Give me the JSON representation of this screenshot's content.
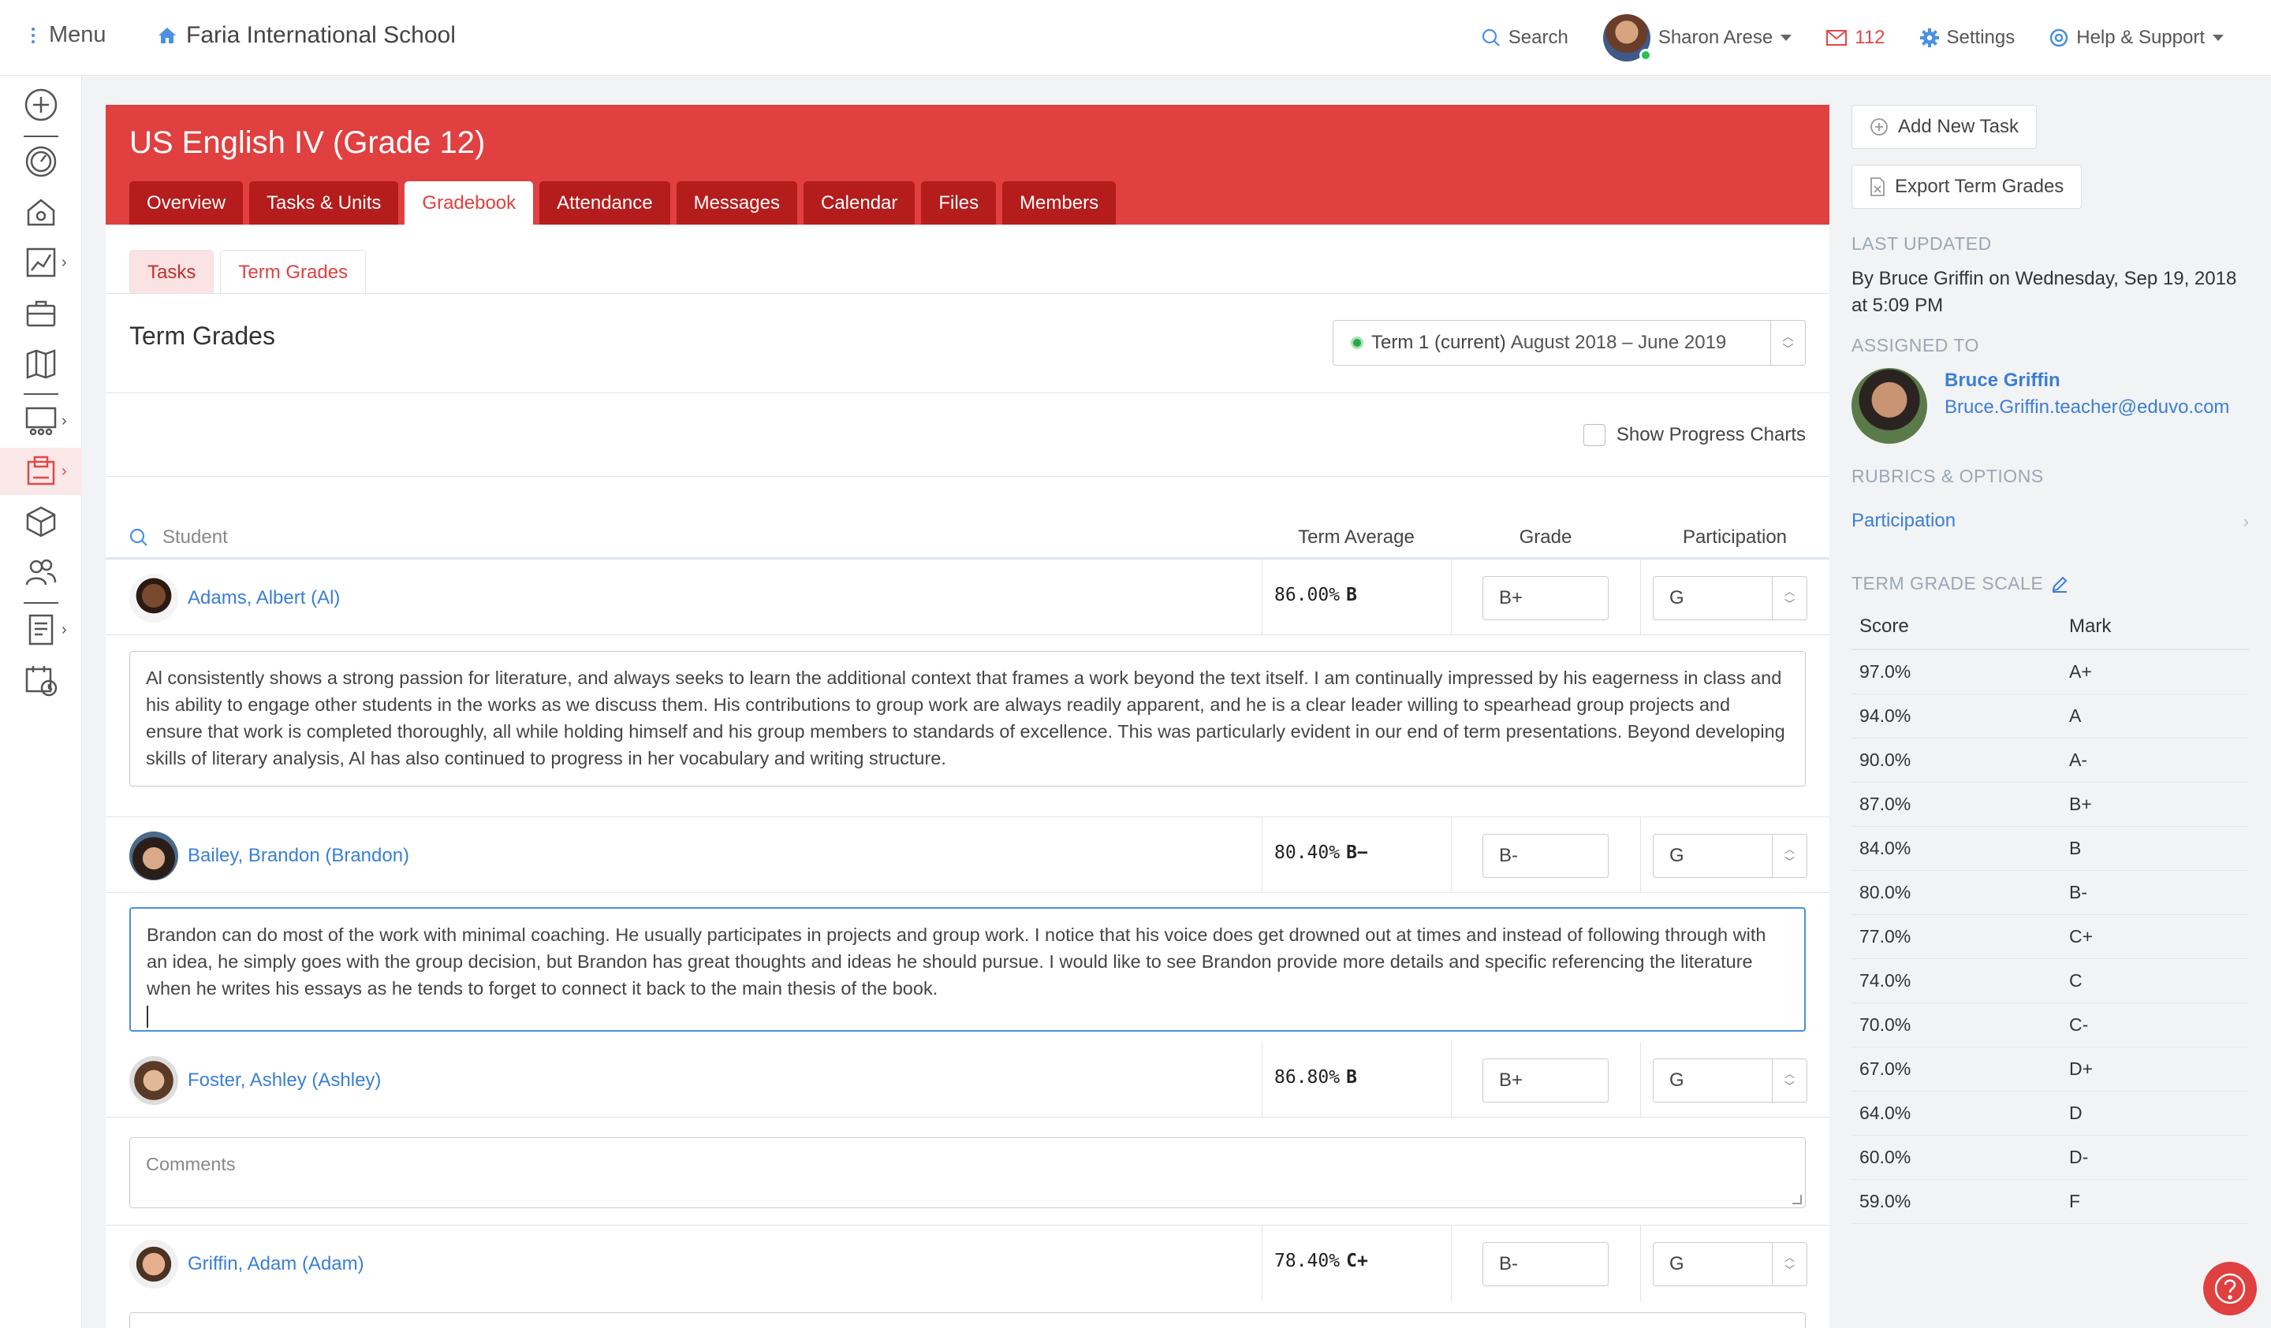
{
  "topbar": {
    "menu_label": "Menu",
    "school_name": "Faria International School",
    "search_label": "Search",
    "user_name": "Sharon Arese",
    "mail_count": "112",
    "settings_label": "Settings",
    "help_label": "Help & Support"
  },
  "course": {
    "title": "US English IV (Grade 12)",
    "tabs": [
      "Overview",
      "Tasks & Units",
      "Gradebook",
      "Attendance",
      "Messages",
      "Calendar",
      "Files",
      "Members"
    ],
    "active_tab": "Gradebook"
  },
  "subtabs": [
    "Tasks",
    "Term Grades"
  ],
  "section_title": "Term Grades",
  "term_select": {
    "label": "Term 1 (current)",
    "dates": "August 2018 – June 2019"
  },
  "show_progress_charts": "Show Progress Charts",
  "table": {
    "student_placeholder": "Student",
    "col_average": "Term Average",
    "col_grade": "Grade",
    "col_participation": "Participation",
    "rows": [
      {
        "name": "Adams, Albert (Al)",
        "average": "86.00%",
        "average_mark": "B",
        "grade": "B+",
        "participation": "G",
        "comment": "Al consistently shows a strong passion for literature, and always seeks to learn the additional context that frames a work beyond the text itself. I am continually impressed by his eagerness in class and his ability to engage other students in the works as we discuss them. His contributions to group work are always readily apparent, and he is a clear leader willing to spearhead group projects and ensure that work is completed thoroughly, all while holding himself and his group members to standards of excellence. This was particularly evident in our end of term presentations. Beyond developing skills of literary analysis, Al has also continued to progress in her vocabulary and writing structure."
      },
      {
        "name": "Bailey, Brandon (Brandon)",
        "average": "80.40%",
        "average_mark": "B−",
        "grade": "B-",
        "participation": "G",
        "comment": "Brandon can do most of the work with minimal coaching. He usually participates in projects and group work. I notice that his voice does get drowned out at times and instead of following through with an idea, he simply goes with the group decision, but Brandon has great thoughts and ideas he should pursue. I would like to see Brandon provide more details and specific referencing the literature when he writes his essays as he tends to forget to connect it back to the main thesis of the book."
      },
      {
        "name": "Foster, Ashley (Ashley)",
        "average": "86.80%",
        "average_mark": "B",
        "grade": "B+",
        "participation": "G",
        "comment_placeholder": "Comments"
      },
      {
        "name": "Griffin, Adam (Adam)",
        "average": "78.40%",
        "average_mark": "C+",
        "grade": "B-",
        "participation": "G"
      }
    ]
  },
  "right_panel": {
    "add_task": "Add New Task",
    "export": "Export Term Grades",
    "last_updated_label": "LAST UPDATED",
    "last_updated_text": "By Bruce Griffin on Wednesday, Sep 19, 2018 at 5:09 PM",
    "assigned_label": "ASSIGNED TO",
    "assignee_name": "Bruce Griffin",
    "assignee_email": "Bruce.Griffin.teacher@eduvo.com",
    "rubrics_label": "RUBRICS & OPTIONS",
    "rubrics_link": "Participation",
    "scale_label": "TERM GRADE SCALE",
    "scale_col_score": "Score",
    "scale_col_mark": "Mark",
    "scale": [
      {
        "score": "97.0%",
        "mark": "A+"
      },
      {
        "score": "94.0%",
        "mark": "A"
      },
      {
        "score": "90.0%",
        "mark": "A-"
      },
      {
        "score": "87.0%",
        "mark": "B+"
      },
      {
        "score": "84.0%",
        "mark": "B"
      },
      {
        "score": "80.0%",
        "mark": "B-"
      },
      {
        "score": "77.0%",
        "mark": "C+"
      },
      {
        "score": "74.0%",
        "mark": "C"
      },
      {
        "score": "70.0%",
        "mark": "C-"
      },
      {
        "score": "67.0%",
        "mark": "D+"
      },
      {
        "score": "64.0%",
        "mark": "D"
      },
      {
        "score": "60.0%",
        "mark": "D-"
      },
      {
        "score": "59.0%",
        "mark": "F"
      }
    ]
  },
  "colors": {
    "brand_red": "#e04040",
    "tab_dark_red": "#b51c1c",
    "link_blue": "#3a7fd5",
    "status_green": "#27a84a"
  },
  "icons": [
    "menu-icon",
    "home-icon",
    "search-icon",
    "mail-icon",
    "gear-icon",
    "help-circle-icon",
    "plus-circle-icon",
    "dashboard-icon",
    "portfolio-icon",
    "chart-icon",
    "briefcase-icon",
    "map-icon",
    "classes-icon",
    "gradebook-icon",
    "cube-icon",
    "users-icon",
    "reports-icon",
    "calendar-icon",
    "file-icon",
    "pencil-icon",
    "chevron-right-icon",
    "question-icon"
  ]
}
